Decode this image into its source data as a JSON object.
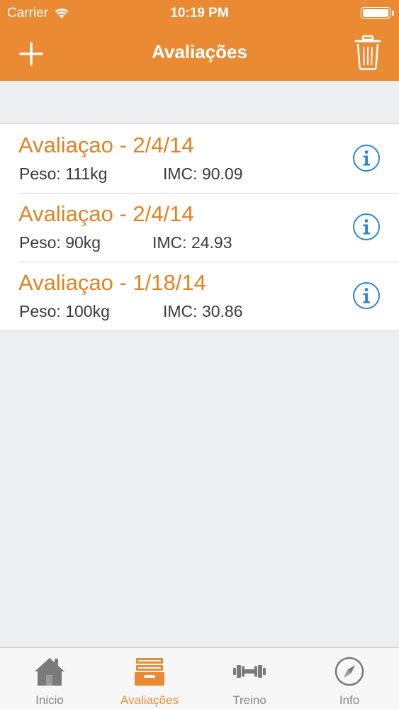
{
  "status_bar": {
    "carrier": "Carrier",
    "time": "10:19 PM",
    "icons": [
      "wifi-icon",
      "battery-icon"
    ]
  },
  "nav_bar": {
    "title": "Avaliações",
    "left_icon": "plus-icon",
    "right_icon": "trash-icon"
  },
  "evaluations": [
    {
      "title": "Avaliaçao - 2/4/14",
      "peso": "Peso: 111kg",
      "imc": "IMC: 90.09"
    },
    {
      "title": "Avaliaçao - 2/4/14",
      "peso": "Peso: 90kg",
      "imc": "IMC: 24.93"
    },
    {
      "title": "Avaliaçao - 1/18/14",
      "peso": "Peso: 100kg",
      "imc": "IMC: 30.86"
    }
  ],
  "tab_bar": {
    "tabs": [
      {
        "label": "Inicio",
        "icon": "house-icon",
        "active": false
      },
      {
        "label": "Avaliações",
        "icon": "file-tray-icon",
        "active": true
      },
      {
        "label": "Treino",
        "icon": "dumbbell-icon",
        "active": false
      },
      {
        "label": "Info",
        "icon": "compass-icon",
        "active": false
      }
    ]
  },
  "colors": {
    "accent": "#ea8b33",
    "row_title": "#e08323",
    "info_icon": "#2a86d8",
    "background": "#eceeef",
    "tab_inactive": "#858585"
  }
}
